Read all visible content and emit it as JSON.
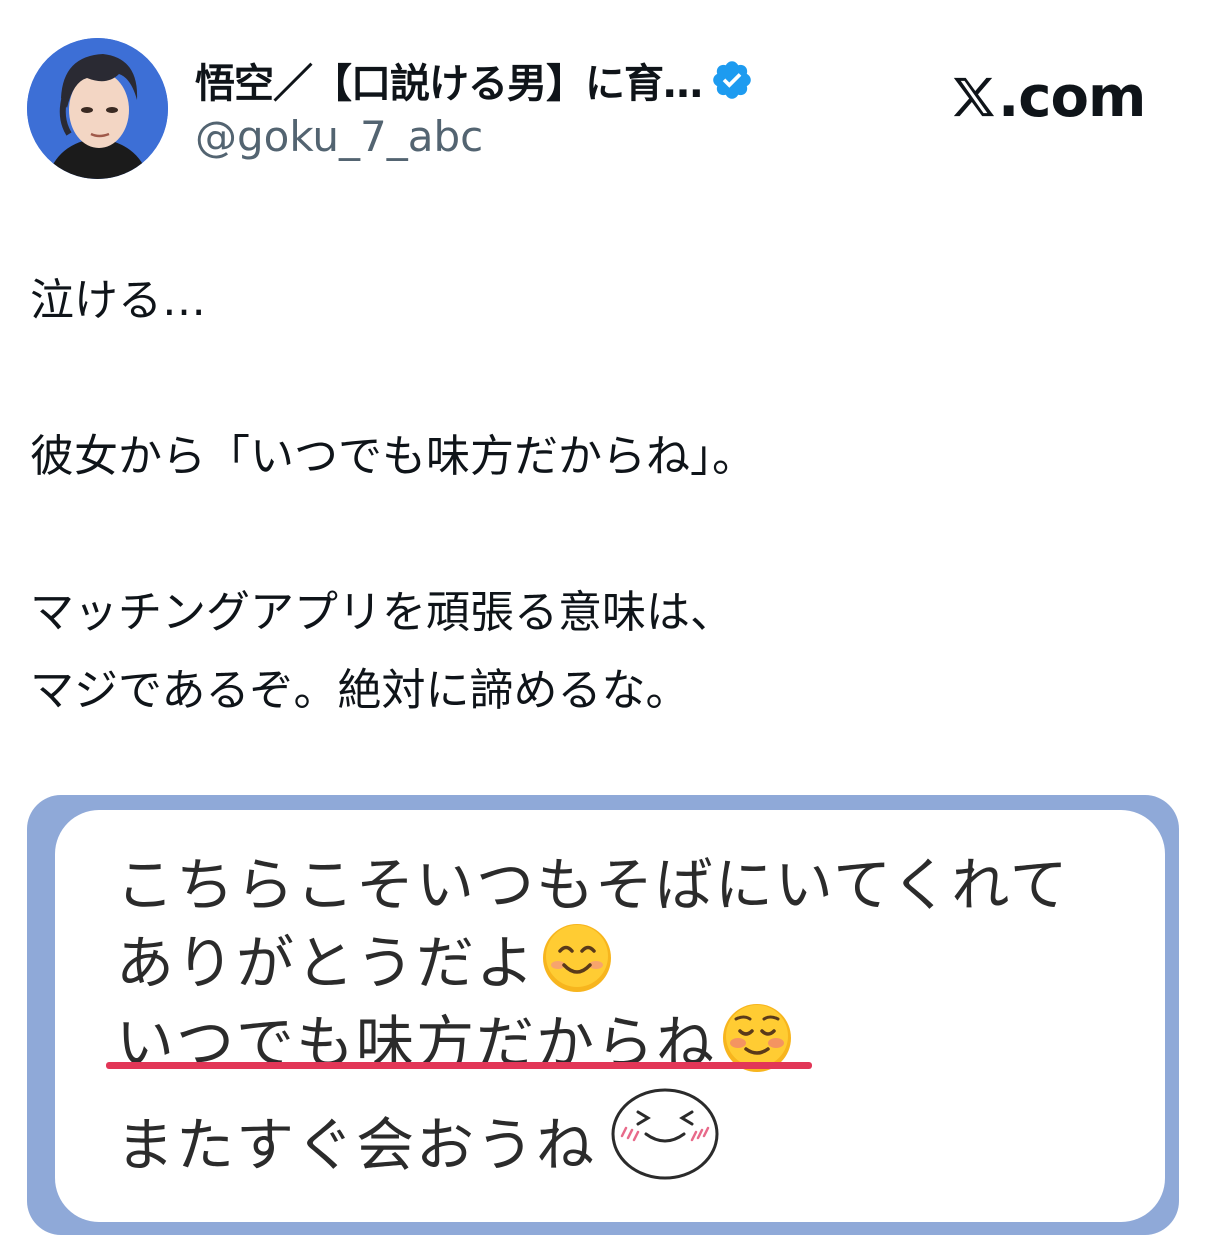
{
  "header": {
    "display_name": "悟空／【口説ける男】に育…",
    "handle": "@goku_7_abc",
    "brand": ".com"
  },
  "tweet": {
    "lines": [
      "泣ける…",
      "彼女から「いつでも味方だからね」。",
      "マッチングアプリを頑張る意味は、",
      "マジであるぞ。絶対に諦めるな。"
    ]
  },
  "screenshot_card": {
    "messages": [
      "こちらこそいつもそばにいてくれて",
      "ありがとうだよ",
      "いつでも味方だからね",
      "またすぐ会おうね"
    ],
    "highlight_color": "#e23657",
    "border_color": "#8fa9d8"
  },
  "colors": {
    "verified": "#1d9bf0",
    "handle": "#536471",
    "text": "#0f1419"
  },
  "icons": [
    "avatar",
    "verified-badge-icon",
    "x-logo-icon",
    "smiling-face-emoji",
    "blushing-face-emoji",
    "drawn-smile-face-icon"
  ]
}
